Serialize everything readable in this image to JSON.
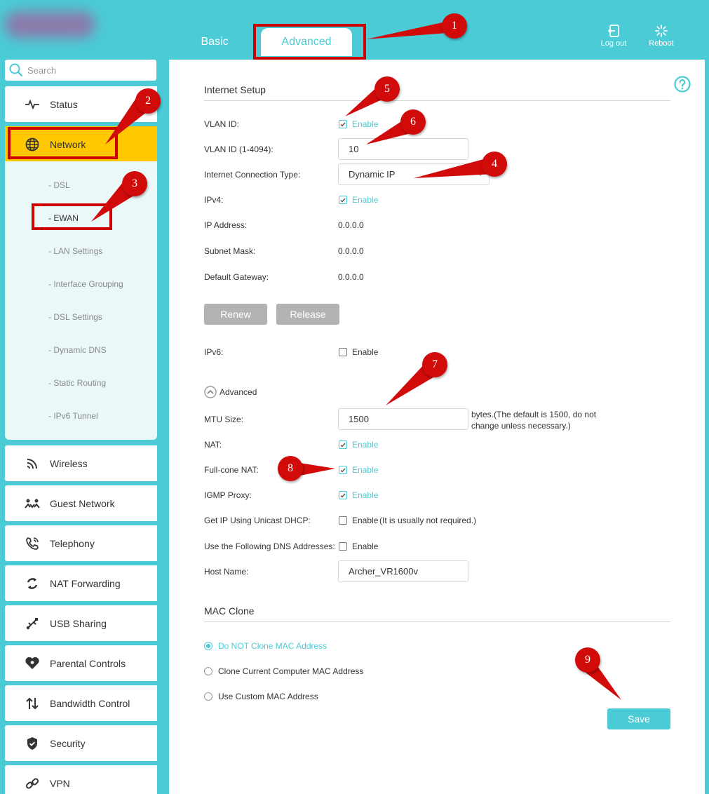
{
  "header": {
    "tabs": [
      {
        "label": "Basic"
      },
      {
        "label": "Advanced"
      }
    ],
    "logout_label": "Log out",
    "reboot_label": "Reboot"
  },
  "sidebar": {
    "search_placeholder": "Search",
    "items": [
      {
        "label": "Status",
        "icon": "pulse-icon"
      },
      {
        "label": "Network",
        "icon": "globe-icon"
      },
      {
        "label": "Wireless",
        "icon": "wifi-icon"
      },
      {
        "label": "Guest Network",
        "icon": "guest-icon"
      },
      {
        "label": "Telephony",
        "icon": "phone-icon"
      },
      {
        "label": "NAT Forwarding",
        "icon": "nat-icon"
      },
      {
        "label": "USB Sharing",
        "icon": "usb-icon"
      },
      {
        "label": "Parental Controls",
        "icon": "heart-icon"
      },
      {
        "label": "Bandwidth Control",
        "icon": "bandwidth-icon"
      },
      {
        "label": "Security",
        "icon": "shield-icon"
      },
      {
        "label": "VPN",
        "icon": "link-icon"
      }
    ],
    "network_sub": [
      "- DSL",
      "- EWAN",
      "- LAN Settings",
      "- Interface Grouping",
      "- DSL Settings",
      "- Dynamic DNS",
      "- Static Routing",
      "- IPv6 Tunnel"
    ]
  },
  "internet_setup": {
    "title": "Internet Setup",
    "vlan_id_label": "VLAN ID:",
    "vlan_range_label": "VLAN ID (1-4094):",
    "vlan_value": "10",
    "conn_type_label": "Internet Connection Type:",
    "conn_type_value": "Dynamic IP",
    "ipv4_label": "IPv4:",
    "ip_address_label": "IP Address:",
    "ip_address_value": "0.0.0.0",
    "subnet_label": "Subnet Mask:",
    "subnet_value": "0.0.0.0",
    "gateway_label": "Default Gateway:",
    "gateway_value": "0.0.0.0",
    "renew_label": "Renew",
    "release_label": "Release",
    "ipv6_label": "IPv6:",
    "enable_label": "Enable",
    "advanced_label": "Advanced",
    "mtu_label": "MTU Size:",
    "mtu_value": "1500",
    "mtu_hint": "bytes.(The default is 1500, do not change unless necessary.)",
    "nat_label": "NAT:",
    "fullcone_label": "Full-cone NAT:",
    "igmp_label": "IGMP Proxy:",
    "unicast_label": "Get IP Using Unicast DHCP:",
    "unicast_hint": "(It is usually not required.)",
    "dns_label": "Use the Following DNS Addresses:",
    "host_label": "Host Name:",
    "host_value": "Archer_VR1600v"
  },
  "mac_clone": {
    "title": "MAC Clone",
    "options": [
      "Do NOT Clone MAC Address",
      "Clone Current Computer MAC Address",
      "Use Custom MAC Address"
    ]
  },
  "save_label": "Save",
  "annotations": [
    "1",
    "2",
    "3",
    "4",
    "5",
    "6",
    "7",
    "8",
    "9"
  ],
  "colors": {
    "accent": "#4acbd6",
    "active_nav": "#ffc800",
    "annotation": "#d10a0a"
  }
}
